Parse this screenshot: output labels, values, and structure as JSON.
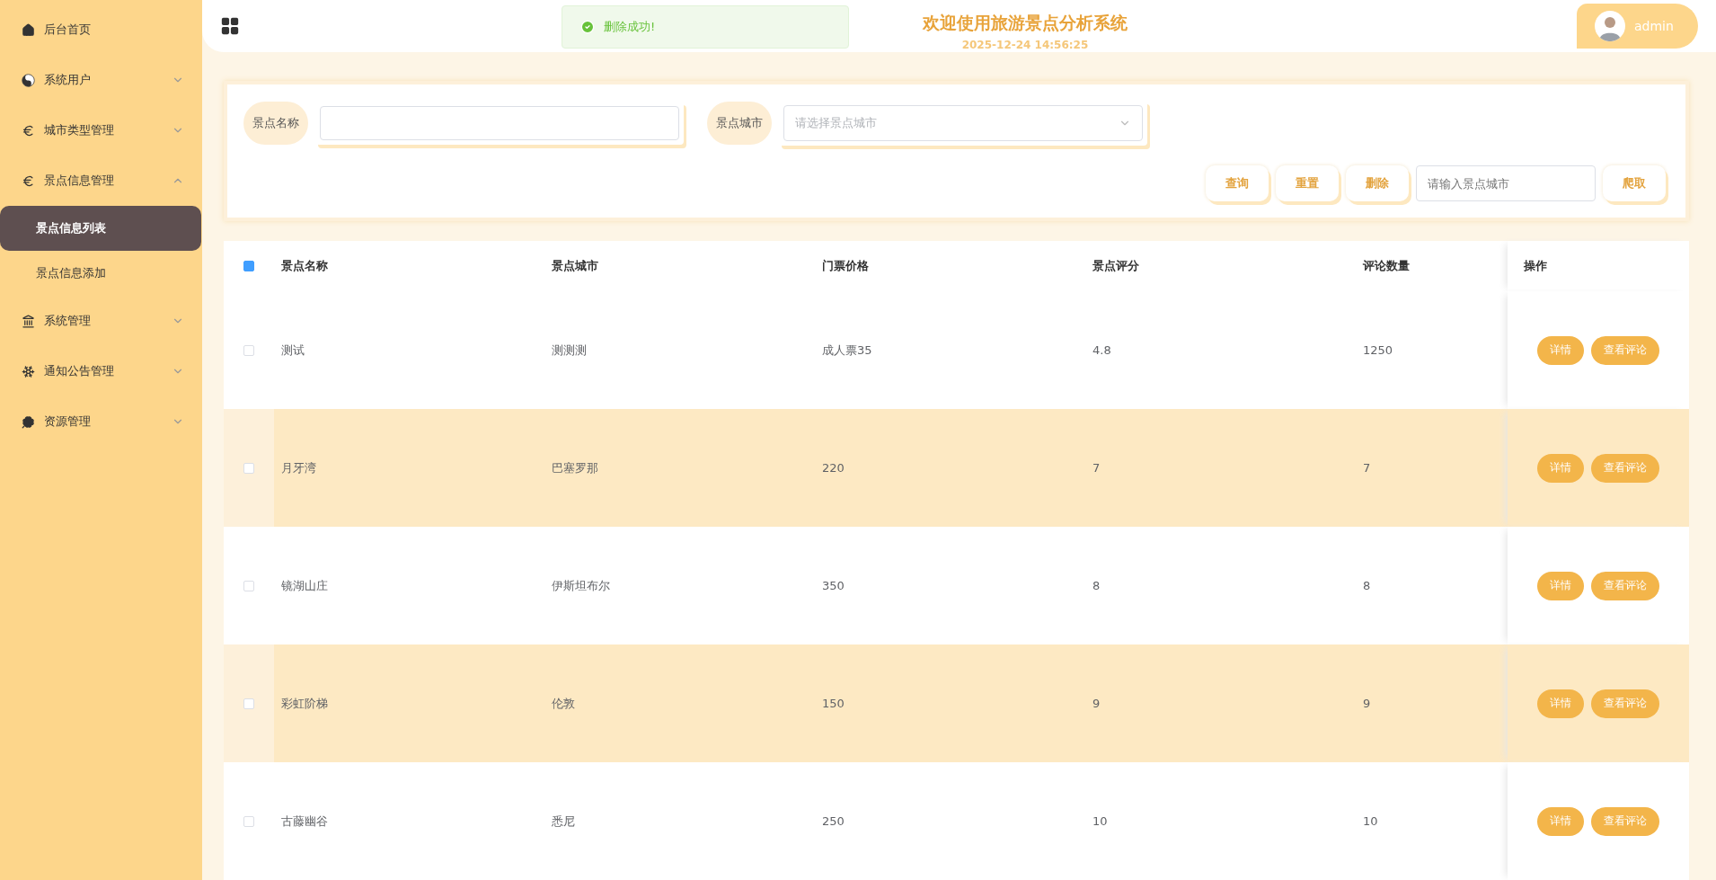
{
  "sidebar": {
    "items": [
      {
        "label": "后台首页",
        "selected": false
      },
      {
        "label": "系统用户",
        "expanded": false,
        "selected": false
      },
      {
        "label": "城市类型管理",
        "expanded": false,
        "selected": false
      },
      {
        "label": "景点信息管理",
        "expanded": true,
        "selected": false,
        "children": [
          {
            "label": "景点信息列表",
            "selected": true
          },
          {
            "label": "景点信息添加",
            "selected": false
          }
        ]
      },
      {
        "label": "系统管理",
        "expanded": false,
        "selected": false
      },
      {
        "label": "通知公告管理",
        "expanded": false,
        "selected": false
      },
      {
        "label": "资源管理",
        "expanded": false,
        "selected": false
      }
    ]
  },
  "header": {
    "title": "欢迎使用旅游景点分析系统",
    "datetime": "2025-12-24 14:56:25",
    "user": "admin"
  },
  "toast": {
    "message": "删除成功!"
  },
  "search": {
    "fields": [
      {
        "label": "景点名称",
        "kind": "input"
      },
      {
        "label": "景点城市",
        "kind": "select",
        "placeholder": "请选择景点城市"
      }
    ],
    "buttons": [
      "查询",
      "重置",
      "删除"
    ],
    "crawl": {
      "placeholder": "请输入景点城市",
      "button": "爬取"
    }
  },
  "table": {
    "all_checked": true,
    "columns": [
      "景点名称",
      "景点城市",
      "门票价格",
      "景点评分",
      "评论数量",
      "操作"
    ],
    "rows": [
      {
        "checked": false,
        "cells": [
          "测试",
          "测测测",
          "成人票35",
          "4.8",
          "1250"
        ],
        "actions": [
          "详情",
          "查看评论"
        ]
      },
      {
        "checked": false,
        "cells": [
          "月牙湾",
          "巴塞罗那",
          "220",
          "7",
          "7"
        ],
        "actions": [
          "详情",
          "查看评论"
        ]
      },
      {
        "checked": false,
        "cells": [
          "镜湖山庄",
          "伊斯坦布尔",
          "350",
          "8",
          "8"
        ],
        "actions": [
          "详情",
          "查看评论"
        ]
      },
      {
        "checked": false,
        "cells": [
          "彩虹阶梯",
          "伦敦",
          "150",
          "9",
          "9"
        ],
        "actions": [
          "详情",
          "查看评论"
        ]
      },
      {
        "checked": false,
        "cells": [
          "古藤幽谷",
          "悉尼",
          "250",
          "10",
          "10"
        ],
        "actions": [
          "详情",
          "查看评论"
        ]
      }
    ]
  }
}
